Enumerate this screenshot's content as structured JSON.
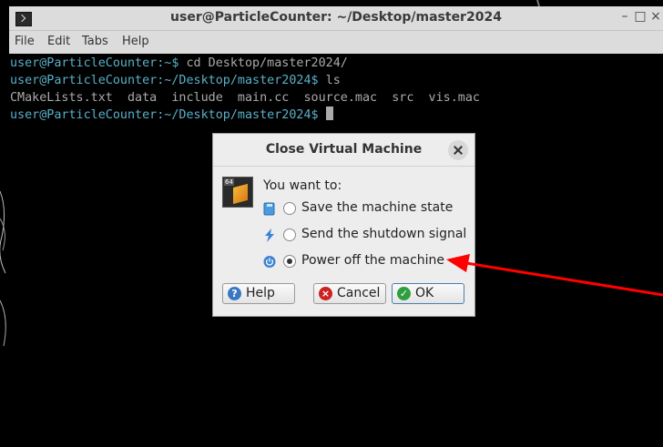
{
  "window": {
    "title": "user@ParticleCounter: ~/Desktop/master2024",
    "minimize": "–",
    "maximize": "□",
    "close": "×"
  },
  "menu": {
    "file": "File",
    "edit": "Edit",
    "tabs": "Tabs",
    "help": "Help"
  },
  "terminal": {
    "lines": [
      {
        "prompt": "user@ParticleCounter:~$",
        "text": " cd Desktop/master2024/"
      },
      {
        "prompt": "user@ParticleCounter:~/Desktop/master2024$",
        "text": " ls"
      },
      {
        "prompt": "",
        "text": "CMakeLists.txt  data  include  main.cc  source.mac  src  vis.mac"
      },
      {
        "prompt": "user@ParticleCounter:~/Desktop/master2024$",
        "text": " "
      }
    ]
  },
  "dialog": {
    "title": "Close Virtual Machine",
    "logo_badge": "64",
    "prompt": "You want to:",
    "options": [
      {
        "label": "Save the machine state",
        "icon": "save-state-icon",
        "checked": false
      },
      {
        "label": "Send the shutdown signal",
        "icon": "lightning-icon",
        "checked": false
      },
      {
        "label": "Power off the machine",
        "icon": "power-icon",
        "checked": true
      }
    ],
    "buttons": {
      "help": "Help",
      "cancel": "Cancel",
      "ok": "OK"
    }
  },
  "colors": {
    "prompt": "#5ab0c8",
    "annotation_arrow": "#ff0000",
    "ok_icon": "#2e9e3e",
    "cancel_icon": "#cc2222",
    "help_icon": "#3b78c4"
  }
}
